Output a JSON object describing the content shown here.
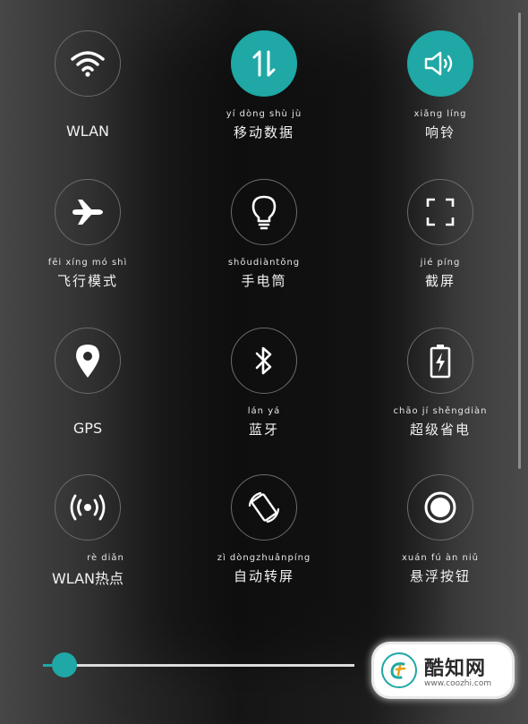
{
  "tiles": [
    {
      "id": "wlan",
      "pinyin": "",
      "label": "WLAN",
      "icon": "wifi-icon",
      "active": false
    },
    {
      "id": "mobile-data",
      "pinyin": "yí  dòng shù  jù",
      "label": "移动数据",
      "icon": "data-arrows-icon",
      "active": true
    },
    {
      "id": "ringtone",
      "pinyin": "xiǎng líng",
      "label": "响铃",
      "icon": "speaker-icon",
      "active": true
    },
    {
      "id": "airplane-mode",
      "pinyin": "fēi xíng mó  shì",
      "label": "飞行模式",
      "icon": "airplane-icon",
      "active": false
    },
    {
      "id": "flashlight",
      "pinyin": "shǒudiàntǒng",
      "label": "手电筒",
      "icon": "lightbulb-icon",
      "active": false
    },
    {
      "id": "screenshot",
      "pinyin": "jié  píng",
      "label": "截屏",
      "icon": "screenshot-frame-icon",
      "active": false
    },
    {
      "id": "gps",
      "pinyin": "",
      "label": "GPS",
      "icon": "location-pin-icon",
      "active": false
    },
    {
      "id": "bluetooth",
      "pinyin": "lán  yá",
      "label": "蓝牙",
      "icon": "bluetooth-icon",
      "active": false
    },
    {
      "id": "power-saving",
      "pinyin": "chāo  jí  shěngdiàn",
      "label": "超级省电",
      "icon": "battery-bolt-icon",
      "active": false
    },
    {
      "id": "hotspot",
      "pinyin": "rè  diǎn",
      "label": "WLAN热点",
      "icon": "hotspot-icon",
      "active": false
    },
    {
      "id": "auto-rotate",
      "pinyin": "zì  dòngzhuǎnpíng",
      "label": "自动转屏",
      "icon": "rotate-icon",
      "active": false
    },
    {
      "id": "floating-button",
      "pinyin": "xuán  fú  àn  niǔ",
      "label": "悬浮按钮",
      "icon": "floating-circle-icon",
      "active": false
    }
  ],
  "brightness": {
    "level_percent": 7
  },
  "watermark": {
    "title": "酷知网",
    "url": "www.coozhi.com"
  },
  "colors": {
    "accent": "#1fa8a5",
    "icon": "#ffffff",
    "ring": "#6b6b6b"
  }
}
